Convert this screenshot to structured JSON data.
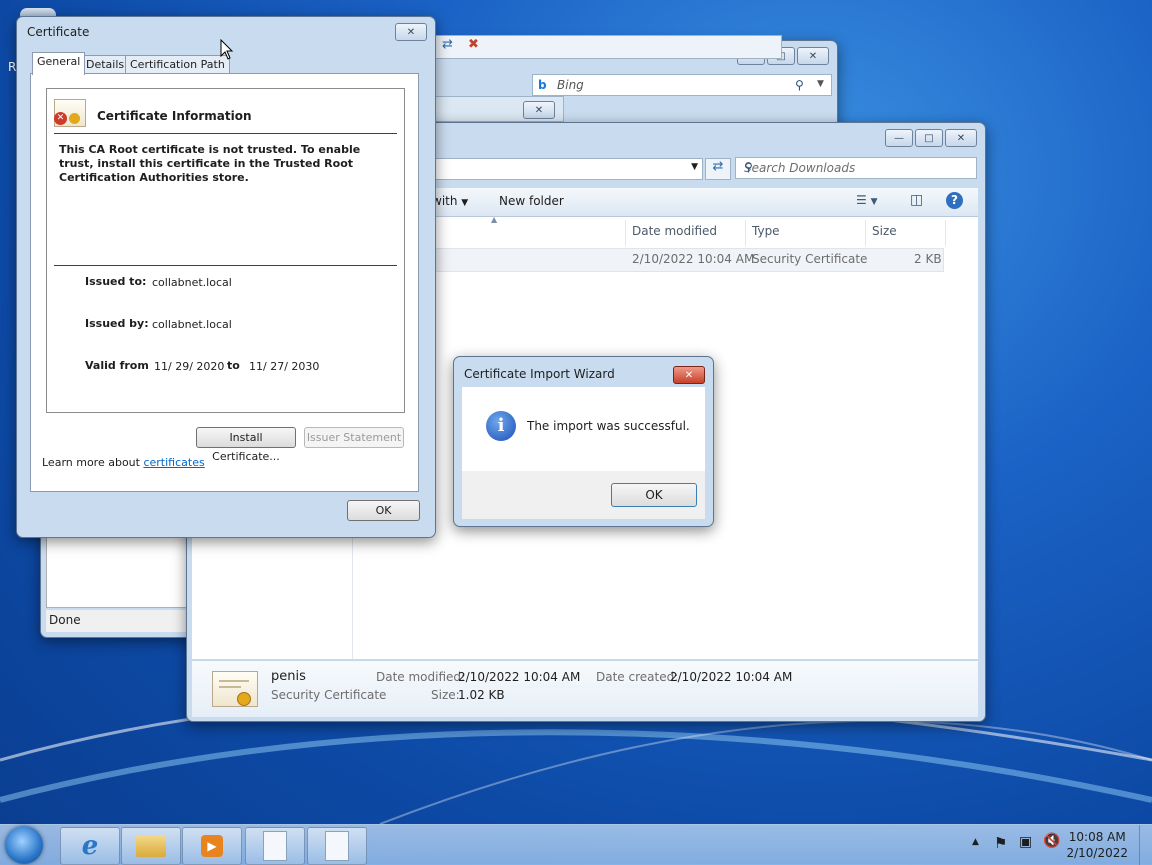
{
  "desktop": {
    "partial_icon_text": "R"
  },
  "back_window": {
    "search_placeholder": "Bing",
    "status": "Done"
  },
  "explorer": {
    "search_placeholder": "Search Downloads",
    "cmd_open_with": "with",
    "cmd_new_folder": "New folder",
    "columns": [
      "Date modified",
      "Type",
      "Size"
    ],
    "file": {
      "date": "2/10/2022 10:04 AM",
      "type": "Security Certificate",
      "size": "2 KB"
    },
    "details": {
      "name": "penis",
      "type": "Security Certificate",
      "date_modified_label": "Date modified:",
      "date_modified": "2/10/2022 10:04 AM",
      "date_created_label": "Date created:",
      "date_created": "2/10/2022 10:04 AM",
      "size_label": "Size:",
      "size": "1.02 KB"
    }
  },
  "cert_dialog": {
    "title": "Certificate",
    "tabs": [
      "General",
      "Details",
      "Certification Path"
    ],
    "info_heading": "Certificate Information",
    "warning": "This CA Root certificate is not trusted. To enable trust, install this certificate in the Trusted Root Certification Authorities store.",
    "issued_to_label": "Issued to:",
    "issued_to": "collabnet.local",
    "issued_by_label": "Issued by:",
    "issued_by": "collabnet.local",
    "valid_from_label": "Valid from",
    "valid_from": "11/ 29/ 2020",
    "to_label": "to",
    "valid_to": "11/ 27/ 2030",
    "install_button": "Install Certificate...",
    "issuer_button": "Issuer Statement",
    "learn_more": "Learn more about",
    "learn_link": "certificates",
    "ok": "OK"
  },
  "wizard": {
    "title": "Certificate Import Wizard",
    "message": "The import was successful.",
    "ok": "OK"
  },
  "taskbar": {
    "time": "10:08 AM",
    "date": "2/10/2022"
  },
  "colors": {
    "accent": "#1b63c6",
    "link": "#0066cc",
    "close_red": "#c7412a"
  }
}
